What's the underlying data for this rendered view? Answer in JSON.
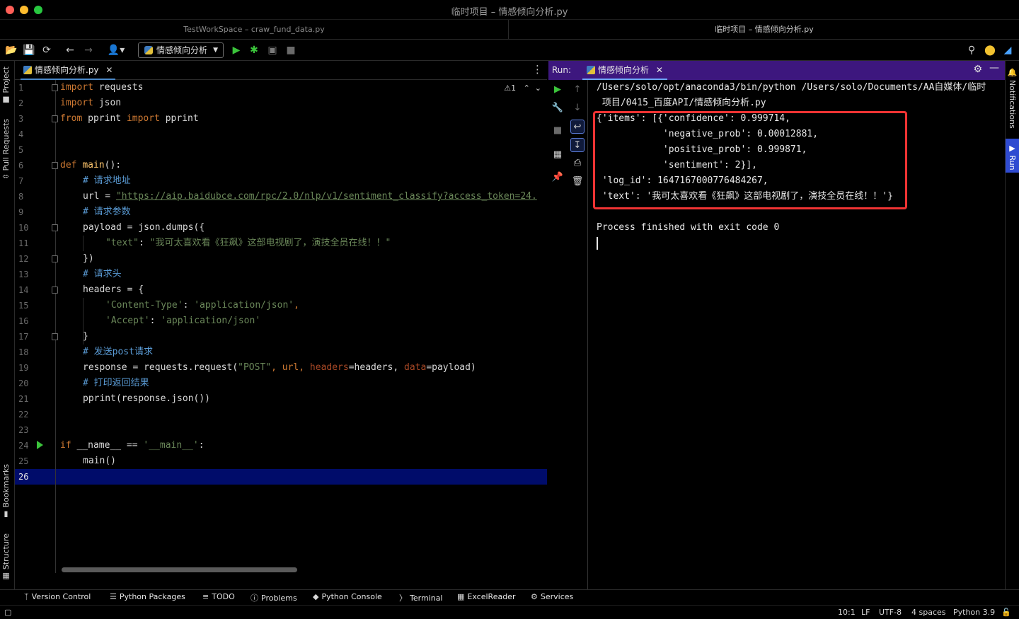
{
  "window": {
    "title": "临时项目 – 情感倾向分析.py",
    "project_tabs": [
      "TestWorkSpace – craw_fund_data.py",
      "临时项目 – 情感倾向分析.py"
    ]
  },
  "toolbar": {
    "run_config": "情感倾向分析"
  },
  "left_stripe": {
    "project": "Project",
    "pull_requests": "Pull Requests",
    "bookmarks": "Bookmarks",
    "structure": "Structure"
  },
  "right_stripe": {
    "notifications": "Notifications",
    "run": "Run"
  },
  "editor": {
    "tab": "情感倾向分析.py",
    "warnings": "1",
    "current_line": "26",
    "line_numbers": [
      "1",
      "2",
      "3",
      "4",
      "5",
      "6",
      "7",
      "8",
      "9",
      "10",
      "11",
      "12",
      "13",
      "14",
      "15",
      "16",
      "17",
      "18",
      "19",
      "20",
      "21",
      "22",
      "23",
      "24",
      "25",
      "26"
    ],
    "lines": {
      "l1_kw": "import",
      "l1_rest": " requests",
      "l2_kw": "import",
      "l2_rest": " json",
      "l3_kw1": "from",
      "l3_mid": " pprint ",
      "l3_kw2": "import",
      "l3_rest": " pprint",
      "l6_kw": "def",
      "l6_fn": "main",
      "l6_rest": "():",
      "l7_cmt": "# 请求地址",
      "l8_a": "url = ",
      "l8_url": "\"https://aip.baidubce.com/rpc/2.0/nlp/v1/sentiment_classify?access_token=24.",
      "l9_cmt": "# 请求参数",
      "l10": "payload = json.dumps({",
      "l11_key": "\"text\"",
      "l11_colon": ": ",
      "l11_val": "\"我可太喜欢看《狂飙》这部电视剧了，演技全员在线！！\"",
      "l12": "})",
      "l13_cmt": "# 请求头",
      "l14": "headers = {",
      "l15_key": "'Content-Type'",
      "l15_colon": ": ",
      "l15_val": "'application/json'",
      "l15_end": ",",
      "l16_key": "'Accept'",
      "l16_colon": ": ",
      "l16_val": "'application/json'",
      "l17": "}",
      "l18_cmt": "# 发送post请求",
      "l19_a": "response = requests.request(",
      "l19_s": "\"POST\"",
      "l19_b": ", url, ",
      "l19_p1": "headers",
      "l19_c": "=headers, ",
      "l19_p2": "data",
      "l19_d": "=payload)",
      "l20_cmt": "# 打印返回结果",
      "l21": "pprint(response.json())",
      "l24_kw": "if",
      "l24_a": " __name__ == ",
      "l24_s": "'__main__'",
      "l24_b": ":",
      "l25": "main()"
    }
  },
  "run_panel": {
    "label": "Run:",
    "tab": "情感倾向分析",
    "output": [
      "/Users/solo/opt/anaconda3/bin/python /Users/solo/Documents/AA自媒体/临时",
      " 项目/0415_百度API/情感倾向分析.py",
      "{'items': [{'confidence': 0.999714,",
      "            'negative_prob': 0.00012881,",
      "            'positive_prob': 0.999871,",
      "            'sentiment': 2}],",
      " 'log_id': 1647167000776484267,",
      " 'text': '我可太喜欢看《狂飙》这部电视剧了，演技全员在线！！'}",
      "",
      "Process finished with exit code 0"
    ]
  },
  "tool_windows": [
    "Version Control",
    "Python Packages",
    "TODO",
    "Problems",
    "Python Console",
    "Terminal",
    "ExcelReader",
    "Services"
  ],
  "status": {
    "position": "10:1",
    "line_sep": "LF",
    "encoding": "UTF-8",
    "indent": "4 spaces",
    "interpreter": "Python 3.9"
  }
}
